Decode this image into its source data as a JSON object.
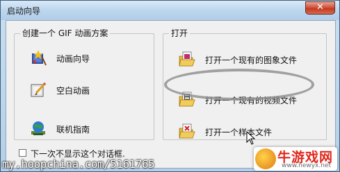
{
  "window": {
    "title": "启动向导",
    "close_label": "✕"
  },
  "left_group": {
    "legend": "创建一个 GIF 动画方案",
    "items": [
      {
        "label": "动画向导",
        "icon": "wizard-icon"
      },
      {
        "label": "空白动画",
        "icon": "blank-animation-icon"
      },
      {
        "label": "联机指南",
        "icon": "online-guide-icon"
      }
    ]
  },
  "right_group": {
    "legend": "打开",
    "items": [
      {
        "label": "打开一个现有的图象文件",
        "icon": "open-image-file-icon"
      },
      {
        "label": "打开一个现有的视频文件",
        "icon": "open-video-file-icon"
      },
      {
        "label": "打开一个样本文件",
        "icon": "open-sample-file-icon"
      }
    ]
  },
  "checkbox": {
    "label": "下一次不显示这个对话框.",
    "checked": false
  },
  "watermark": {
    "text": "my.hoopchina.com/5161765"
  },
  "site_badge": {
    "name": "牛游戏网",
    "url": "www.newyx.net"
  },
  "colors": {
    "title_bar": "#c9dff1",
    "close_button": "#c23a20",
    "client_bg": "#f0f0f0",
    "highlight_oval": "#8c8c8c"
  }
}
